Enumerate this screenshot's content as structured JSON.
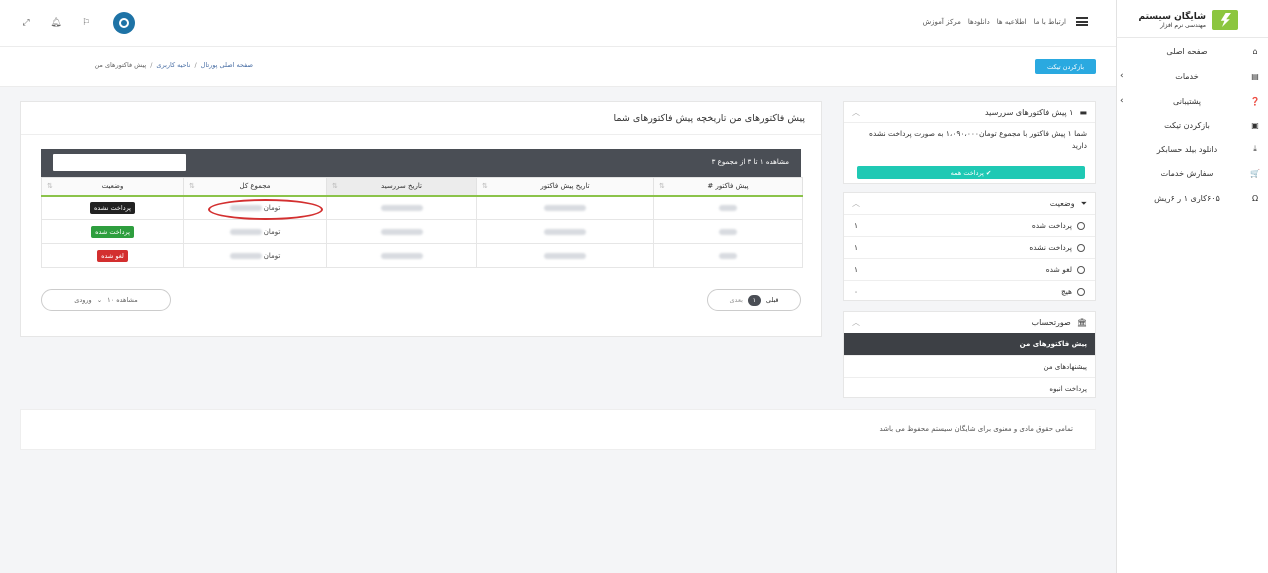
{
  "brand": {
    "title": "شایگان سیستم",
    "subtitle": "مهندسی نرم افزار"
  },
  "sidebar": {
    "items": [
      {
        "label": "صفحه اصلی",
        "icon": "home-icon",
        "glyph": "⌂",
        "chevron": ""
      },
      {
        "label": "خدمات",
        "icon": "server-icon",
        "glyph": "▤",
        "chevron": "›"
      },
      {
        "label": "پشتیبانی",
        "icon": "help-icon",
        "glyph": "❓",
        "chevron": "›"
      },
      {
        "label": "بازکردن تیکت",
        "icon": "ticket-icon",
        "glyph": "▣",
        "chevron": ""
      },
      {
        "label": "دانلود بیلد حسابکر",
        "icon": "download-icon",
        "glyph": "⤓",
        "chevron": ""
      },
      {
        "label": "سفارش خدمات",
        "icon": "cart-icon",
        "glyph": "🛒",
        "chevron": ""
      },
      {
        "label": "۶۰۵کاری ۱ ر ۶ریش",
        "icon": "omega-icon",
        "glyph": "Ω",
        "chevron": ""
      }
    ]
  },
  "topnav": {
    "links": [
      "ارتباط با ما",
      "اطلاعیه ها",
      "دانلودها",
      "مرکز آموزش"
    ],
    "icons": [
      "expand-icon",
      "bell-icon",
      "flag-icon"
    ]
  },
  "breadcrumb": {
    "home": "صفحه اصلی پورتال",
    "area": "ناحیه کاربری",
    "current": "پیش فاکتورهای من"
  },
  "open_ticket_button": "بازکردن تیکت",
  "due_panel": {
    "title": "۱ پیش فاکتورهای سررسید",
    "text": "شما ۱ پیش فاکتور با مجموع تومان۱،۰۹۰،۰۰۰ به صورت پرداخت نشده دارید",
    "pay_all": "پرداخت همه"
  },
  "status_panel": {
    "title": "وضعیت",
    "options": [
      {
        "label": "پرداخت شده",
        "count": "۱"
      },
      {
        "label": "پرداخت نشده",
        "count": "۱"
      },
      {
        "label": "لغو شده",
        "count": "۱"
      },
      {
        "label": "هیچ",
        "count": "۰"
      }
    ]
  },
  "billing_panel": {
    "title": "صورتحساب",
    "items": [
      "پیش فاکتورهای من",
      "پیشنهادهای من",
      "پرداخت انبوه"
    ]
  },
  "main": {
    "title": "پیش فاکتورهای من تاریخچه پیش فاکتورهای شما",
    "table_count": "مشاهده ۱ تا ۳ از مجموع ۳",
    "columns": [
      "پیش فاکتور #",
      "تاریخ پیش فاکتور",
      "تاریخ سررسید",
      "مجموع کل",
      "وضعیت"
    ],
    "rows": [
      {
        "currency": "تومان",
        "status": "پرداخت نشده",
        "status_color": "#222222"
      },
      {
        "currency": "تومان",
        "status": "پرداخت شده",
        "status_color": "#2e9e3e"
      },
      {
        "currency": "تومان",
        "status": "لغو شده",
        "status_color": "#d32f2f"
      }
    ],
    "pager": {
      "prev": "قبلی",
      "current": "۱",
      "next": "بعدی"
    },
    "per_page": {
      "label": "مشاهده ۱۰",
      "suffix": "ورودی"
    }
  },
  "footer": "تمامی حقوق مادی و معنوی برای شایگان سیستم محفوظ می باشد"
}
